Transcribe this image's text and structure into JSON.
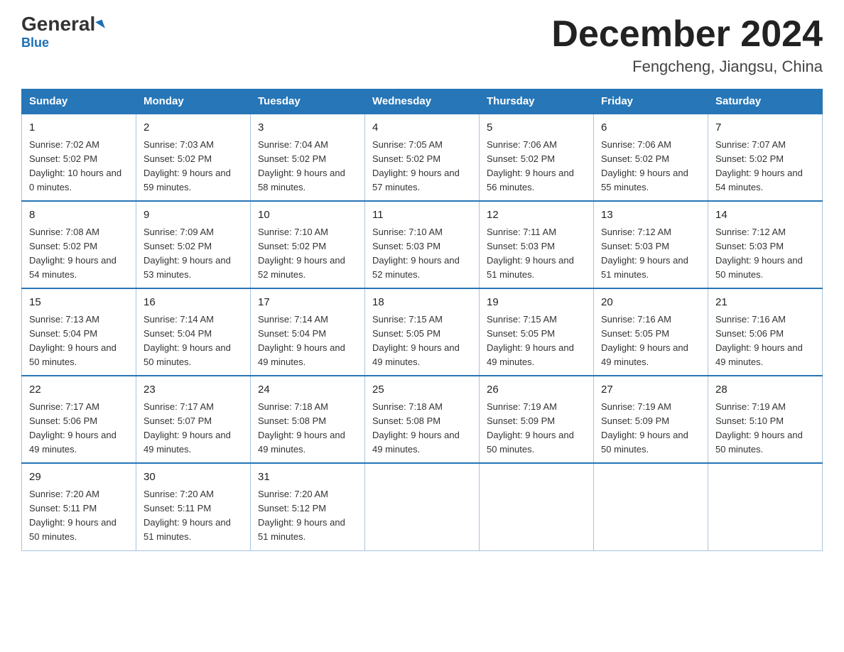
{
  "header": {
    "logo_general": "General",
    "logo_blue": "Blue",
    "month_title": "December 2024",
    "location": "Fengcheng, Jiangsu, China"
  },
  "weekdays": [
    "Sunday",
    "Monday",
    "Tuesday",
    "Wednesday",
    "Thursday",
    "Friday",
    "Saturday"
  ],
  "weeks": [
    [
      {
        "day": "1",
        "sunrise": "7:02 AM",
        "sunset": "5:02 PM",
        "daylight": "10 hours and 0 minutes."
      },
      {
        "day": "2",
        "sunrise": "7:03 AM",
        "sunset": "5:02 PM",
        "daylight": "9 hours and 59 minutes."
      },
      {
        "day": "3",
        "sunrise": "7:04 AM",
        "sunset": "5:02 PM",
        "daylight": "9 hours and 58 minutes."
      },
      {
        "day": "4",
        "sunrise": "7:05 AM",
        "sunset": "5:02 PM",
        "daylight": "9 hours and 57 minutes."
      },
      {
        "day": "5",
        "sunrise": "7:06 AM",
        "sunset": "5:02 PM",
        "daylight": "9 hours and 56 minutes."
      },
      {
        "day": "6",
        "sunrise": "7:06 AM",
        "sunset": "5:02 PM",
        "daylight": "9 hours and 55 minutes."
      },
      {
        "day": "7",
        "sunrise": "7:07 AM",
        "sunset": "5:02 PM",
        "daylight": "9 hours and 54 minutes."
      }
    ],
    [
      {
        "day": "8",
        "sunrise": "7:08 AM",
        "sunset": "5:02 PM",
        "daylight": "9 hours and 54 minutes."
      },
      {
        "day": "9",
        "sunrise": "7:09 AM",
        "sunset": "5:02 PM",
        "daylight": "9 hours and 53 minutes."
      },
      {
        "day": "10",
        "sunrise": "7:10 AM",
        "sunset": "5:02 PM",
        "daylight": "9 hours and 52 minutes."
      },
      {
        "day": "11",
        "sunrise": "7:10 AM",
        "sunset": "5:03 PM",
        "daylight": "9 hours and 52 minutes."
      },
      {
        "day": "12",
        "sunrise": "7:11 AM",
        "sunset": "5:03 PM",
        "daylight": "9 hours and 51 minutes."
      },
      {
        "day": "13",
        "sunrise": "7:12 AM",
        "sunset": "5:03 PM",
        "daylight": "9 hours and 51 minutes."
      },
      {
        "day": "14",
        "sunrise": "7:12 AM",
        "sunset": "5:03 PM",
        "daylight": "9 hours and 50 minutes."
      }
    ],
    [
      {
        "day": "15",
        "sunrise": "7:13 AM",
        "sunset": "5:04 PM",
        "daylight": "9 hours and 50 minutes."
      },
      {
        "day": "16",
        "sunrise": "7:14 AM",
        "sunset": "5:04 PM",
        "daylight": "9 hours and 50 minutes."
      },
      {
        "day": "17",
        "sunrise": "7:14 AM",
        "sunset": "5:04 PM",
        "daylight": "9 hours and 49 minutes."
      },
      {
        "day": "18",
        "sunrise": "7:15 AM",
        "sunset": "5:05 PM",
        "daylight": "9 hours and 49 minutes."
      },
      {
        "day": "19",
        "sunrise": "7:15 AM",
        "sunset": "5:05 PM",
        "daylight": "9 hours and 49 minutes."
      },
      {
        "day": "20",
        "sunrise": "7:16 AM",
        "sunset": "5:05 PM",
        "daylight": "9 hours and 49 minutes."
      },
      {
        "day": "21",
        "sunrise": "7:16 AM",
        "sunset": "5:06 PM",
        "daylight": "9 hours and 49 minutes."
      }
    ],
    [
      {
        "day": "22",
        "sunrise": "7:17 AM",
        "sunset": "5:06 PM",
        "daylight": "9 hours and 49 minutes."
      },
      {
        "day": "23",
        "sunrise": "7:17 AM",
        "sunset": "5:07 PM",
        "daylight": "9 hours and 49 minutes."
      },
      {
        "day": "24",
        "sunrise": "7:18 AM",
        "sunset": "5:08 PM",
        "daylight": "9 hours and 49 minutes."
      },
      {
        "day": "25",
        "sunrise": "7:18 AM",
        "sunset": "5:08 PM",
        "daylight": "9 hours and 49 minutes."
      },
      {
        "day": "26",
        "sunrise": "7:19 AM",
        "sunset": "5:09 PM",
        "daylight": "9 hours and 50 minutes."
      },
      {
        "day": "27",
        "sunrise": "7:19 AM",
        "sunset": "5:09 PM",
        "daylight": "9 hours and 50 minutes."
      },
      {
        "day": "28",
        "sunrise": "7:19 AM",
        "sunset": "5:10 PM",
        "daylight": "9 hours and 50 minutes."
      }
    ],
    [
      {
        "day": "29",
        "sunrise": "7:20 AM",
        "sunset": "5:11 PM",
        "daylight": "9 hours and 50 minutes."
      },
      {
        "day": "30",
        "sunrise": "7:20 AM",
        "sunset": "5:11 PM",
        "daylight": "9 hours and 51 minutes."
      },
      {
        "day": "31",
        "sunrise": "7:20 AM",
        "sunset": "5:12 PM",
        "daylight": "9 hours and 51 minutes."
      },
      null,
      null,
      null,
      null
    ]
  ],
  "labels": {
    "sunrise": "Sunrise: ",
    "sunset": "Sunset: ",
    "daylight": "Daylight: "
  }
}
